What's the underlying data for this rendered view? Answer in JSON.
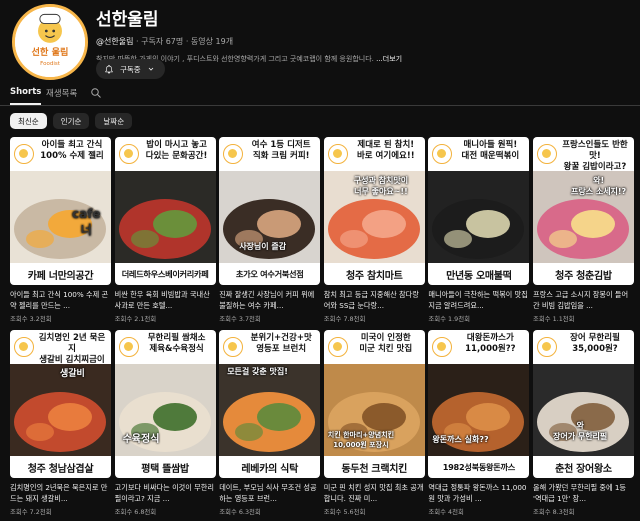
{
  "channel": {
    "name": "선한울림",
    "handle": "@선한울림",
    "subscribers": "구독자 67명",
    "videos": "동영상 19개",
    "description": "착지만 따뜻한 가게의 이야기 , 푸디스트와 선한영향력가게 그리고 굿예코랩이 함께 응원합니다.",
    "more": "...더보기",
    "subscribe_label": "구독중",
    "avatar_text": "선한 울림",
    "avatar_sub": "Foodist"
  },
  "tabs": [
    {
      "label": "Shorts"
    },
    {
      "label": "재생목록"
    }
  ],
  "chips": [
    {
      "label": "최신순"
    },
    {
      "label": "인기순"
    },
    {
      "label": "날짜순"
    }
  ],
  "cards": [
    {
      "top": "아이들 최고 간식\n100% 수제 젤리",
      "bottom": "카페 너만의공간",
      "overlay": "cafe\n너",
      "title": "아이들 최고 간식 100% 수제 곤약 젤리를 만드는 ...",
      "views": "조회수 3.2천회",
      "colors": [
        "#e9e2d6",
        "#c9b9a4",
        "#f2a93b"
      ]
    },
    {
      "top": "밥이 마시고 놓고\n다있는 문화공간!",
      "bottom": "더레드하우스베이커리카페",
      "overlay": "",
      "title": "비싼 한우 육회 비빔밥과 국내산 사과로 만든 호텔...",
      "views": "조회수 2.1천회",
      "colors": [
        "#2b2a26",
        "#b0342b",
        "#6b8f3a"
      ]
    },
    {
      "top": "여수 1등 디저트\n직화 크림 커피!",
      "bottom": "초가오 여수거북선점",
      "overlay": "사장님이 즐감",
      "title": "진짜 잘생긴 사장님이 커피 위에 불질하는 여수 카페...",
      "views": "조회수 3.7천회",
      "colors": [
        "#d8d4cf",
        "#3a2d25",
        "#c99a76"
      ]
    },
    {
      "top": "제대로 된 참치!\n바로 여기에요!!",
      "bottom": "청주 참치마트",
      "overlay": "구성과 참치맛이\n너무 좋아요~!!",
      "title": "참치 최고 등급 지중해산 참다랑어와 SS급 눈다랑...",
      "views": "조회수 7.8천회",
      "colors": [
        "#e8ddd0",
        "#e46b46",
        "#f3a184"
      ]
    },
    {
      "top": "매니아들 원픽!\n대전 매운떡볶이",
      "bottom": "만년동 오매불떡",
      "overlay": "",
      "title": "매니아들이 극찬하는 떡볶이 맛집 지금 알려드려요...",
      "views": "조회수 1.9천회",
      "colors": [
        "#222",
        "#1c1c1c",
        "#c8c3a0"
      ]
    },
    {
      "top": "프랑스인들도 반한 맛!\n왕꿀 김밥이라고?",
      "bottom": "청주 청춘김밥",
      "overlay": "와!\n프랑스 소세지!?",
      "title": "프랑스 고급 소시지 장봉이 들어간 비빔 김밥임을 ...",
      "views": "조회수 1.1천회",
      "colors": [
        "#cfc5bd",
        "#d86a8a",
        "#f5d48a"
      ]
    },
    {
      "top": "김치명인 2년 묵은지\n생갈비 김치찌금이",
      "bottom": "청주 청남삼겹살",
      "overlay": "생갈비",
      "title": "김치명인의 2년묵은 묵은지로 만드는 돼지 생갈비...",
      "views": "조회수 7.2천회",
      "colors": [
        "#3a2a20",
        "#c24a2d",
        "#e87b3d"
      ]
    },
    {
      "top": "무한리필 쌈채소\n제육&수육정식",
      "bottom": "평택 뜰쌈밥",
      "overlay": "수육정식",
      "title": "고기보다 비싸다는 이것이 무한리필이라고? 지금 ...",
      "views": "조회수 6.8천회",
      "colors": [
        "#d9d3c9",
        "#e9dfcf",
        "#4f7a3b"
      ]
    },
    {
      "top": "분위기+건강+맛\n영등포 브런치",
      "bottom": "레베카의 식탁",
      "overlay": "모든걸 갖춘 맛집!",
      "title": "데이트, 부모님 식사 무조건 성공하는 영등포 브런...",
      "views": "조회수 6.3천회",
      "colors": [
        "#3b332b",
        "#e58a3b",
        "#6a8a3c"
      ]
    },
    {
      "top": "미국이 인정한\n미군 치킨 맛집",
      "bottom": "동두천 크랙치킨",
      "overlay": "치킨 한마리+양념치킨\n10,000원 포장시",
      "title": "미군 핀 치킨 성지 맛집 최초 공개합니다. 진짜 미...",
      "views": "조회수 5.6천회",
      "colors": [
        "#bf8a4a",
        "#d9a25e",
        "#8b5a2b"
      ]
    },
    {
      "top": "대왕돈까스가\n11,000원??",
      "bottom": "1982성북동왕돈까스",
      "overlay": "왕돈까스 실화??",
      "title": "역대급 정통파 왕돈까스 11,000원 맛과 가성비 ...",
      "views": "조회수 4천회",
      "colors": [
        "#2b2018",
        "#b5622d",
        "#d98a45"
      ]
    },
    {
      "top": "장어 무한리필\n35,000원?",
      "bottom": "춘천 장어왕소",
      "overlay": "와\n장어가 무한리필",
      "title": "올해 가봤던 무한리필 중에 1등 '역대급 1만' 장...",
      "views": "조회수 8.3천회",
      "colors": [
        "#2a2a2a",
        "#d8cfc3",
        "#8a6a4a"
      ]
    }
  ]
}
